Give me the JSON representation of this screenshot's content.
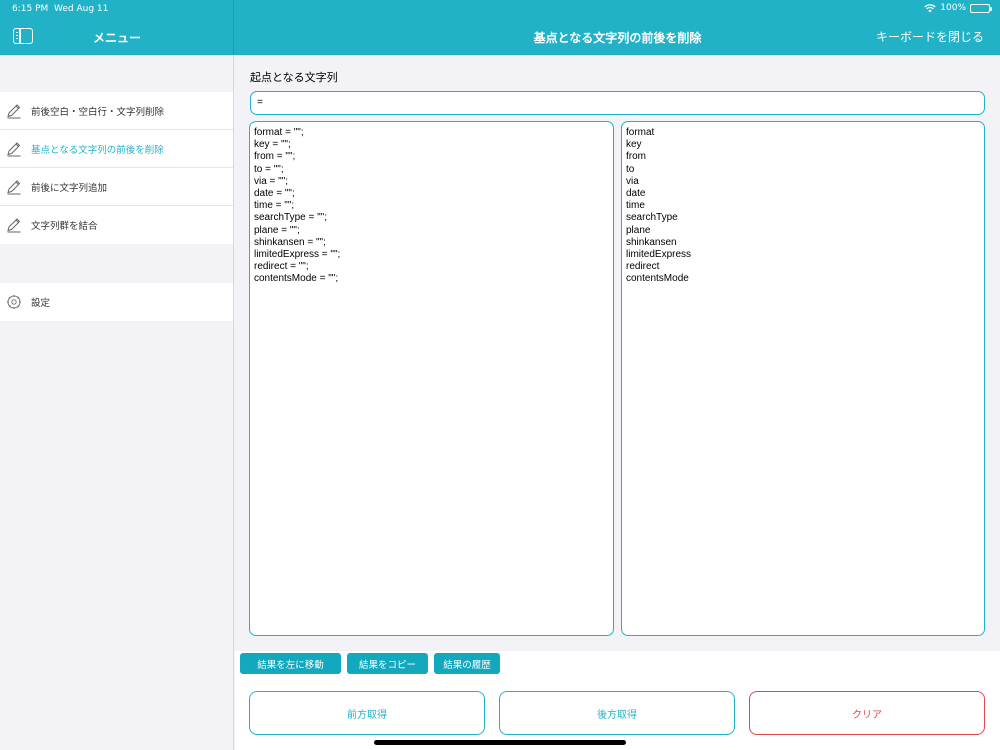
{
  "status": {
    "time": "6:15 PM",
    "date": "Wed Aug 11",
    "battery": "100%"
  },
  "header": {
    "menu_title": "メニュー",
    "page_title": "基点となる文字列の前後を削除",
    "close_keyboard": "キーボードを閉じる"
  },
  "sidebar": {
    "items": [
      {
        "label": "前後空白・空白行・文字列削除",
        "icon": "pencil-icon"
      },
      {
        "label": "基点となる文字列の前後を削除",
        "icon": "pencil-icon",
        "active": true
      },
      {
        "label": "前後に文字列追加",
        "icon": "pencil-icon"
      },
      {
        "label": "文字列群を結合",
        "icon": "pencil-icon"
      }
    ],
    "settings": {
      "label": "設定",
      "icon": "gear-icon"
    }
  },
  "main": {
    "base_label": "起点となる文字列",
    "base_value": "=",
    "left_lines": [
      "format = \"\";",
      "key = \"\";",
      "from = \"\";",
      "to = \"\";",
      "via = \"\";",
      "date = \"\";",
      "time = \"\";",
      "searchType = \"\";",
      "plane = \"\";",
      "shinkansen = \"\";",
      "limitedExpress = \"\";",
      "redirect = \"\";",
      "contentsMode = \"\";"
    ],
    "right_lines": [
      "format",
      "key",
      "from",
      "to",
      "via",
      "date",
      "time",
      "searchType",
      "plane",
      "shinkansen",
      "limitedExpress",
      "redirect",
      "contentsMode"
    ]
  },
  "actions": {
    "move_left": "結果を左に移動",
    "copy": "結果をコピー",
    "history": "結果の履歴",
    "get_front": "前方取得",
    "get_back": "後方取得",
    "clear": "クリア"
  },
  "colors": {
    "accent": "#22b2c8",
    "danger": "#e0474c"
  }
}
